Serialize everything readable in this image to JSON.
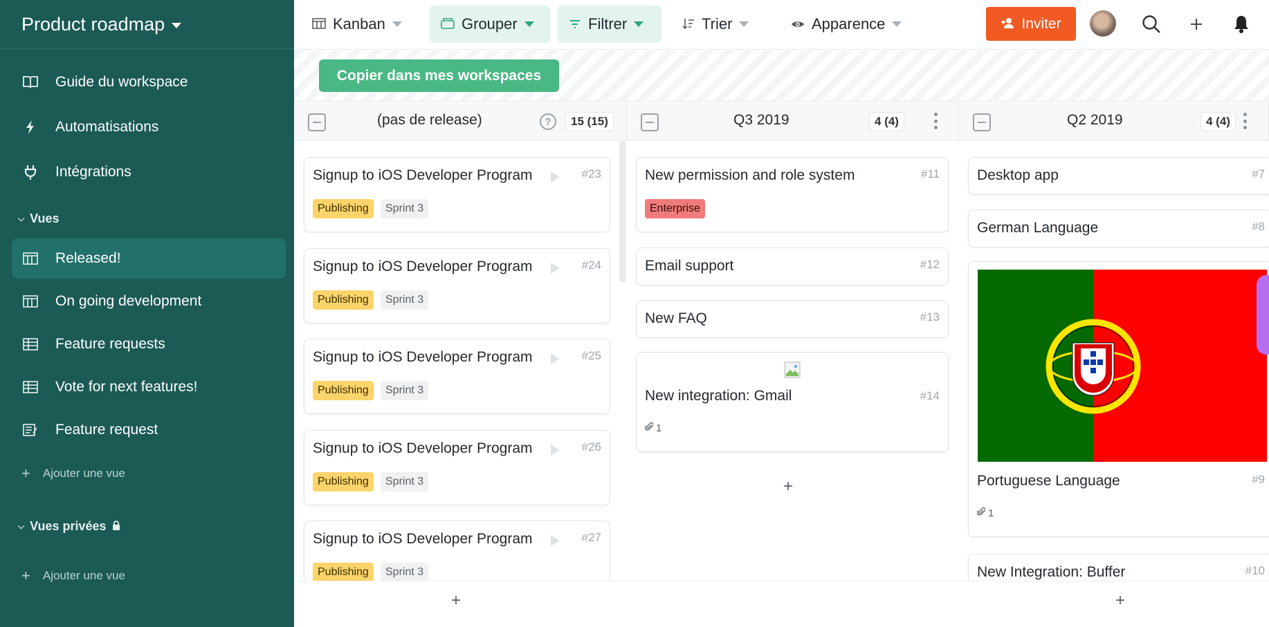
{
  "sidebar": {
    "title": "Product roadmap",
    "items": [
      {
        "label": "Guide du workspace",
        "icon": "book-icon"
      },
      {
        "label": "Automatisations",
        "icon": "bolt-icon"
      },
      {
        "label": "Intégrations",
        "icon": "plug-icon"
      }
    ],
    "views_section": "Vues",
    "views": [
      {
        "label": "Released!",
        "icon": "kanban-icon",
        "active": true
      },
      {
        "label": "On going development",
        "icon": "kanban-icon",
        "active": false
      },
      {
        "label": "Feature requests",
        "icon": "table-icon",
        "active": false
      },
      {
        "label": "Vote for next features!",
        "icon": "table-icon",
        "active": false
      },
      {
        "label": "Feature request",
        "icon": "form-icon",
        "active": false
      }
    ],
    "add_view": "Ajouter une vue",
    "private_section": "Vues privées",
    "add_private_view": "Ajouter une vue"
  },
  "toolbar": {
    "kanban": "Kanban",
    "group": "Grouper",
    "filter": "Filtrer",
    "sort": "Trier",
    "appearance": "Apparence",
    "invite": "Inviter"
  },
  "banner": {
    "copy": "Copier dans mes workspaces"
  },
  "columns": [
    {
      "title": "(pas de release)",
      "count": "15 (15)",
      "cards": [
        {
          "title": "Signup to iOS Developer Program",
          "id": "#23",
          "tags": [
            "Publishing",
            "Sprint 3"
          ]
        },
        {
          "title": "Signup to iOS Developer Program",
          "id": "#24",
          "tags": [
            "Publishing",
            "Sprint 3"
          ]
        },
        {
          "title": "Signup to iOS Developer Program",
          "id": "#25",
          "tags": [
            "Publishing",
            "Sprint 3"
          ]
        },
        {
          "title": "Signup to iOS Developer Program",
          "id": "#26",
          "tags": [
            "Publishing",
            "Sprint 3"
          ]
        },
        {
          "title": "Signup to iOS Developer Program",
          "id": "#27",
          "tags": [
            "Publishing",
            "Sprint 3"
          ]
        }
      ]
    },
    {
      "title": "Q3 2019",
      "count": "4 (4)",
      "cards": [
        {
          "title": "New permission and role system",
          "id": "#11",
          "tags": [
            "Enterprise"
          ]
        },
        {
          "title": "Email support",
          "id": "#12"
        },
        {
          "title": "New FAQ",
          "id": "#13"
        },
        {
          "title": "New integration: Gmail",
          "id": "#14",
          "attachments": "1"
        }
      ]
    },
    {
      "title": "Q2 2019",
      "count": "4 (4)",
      "cards": [
        {
          "title": "Desktop app",
          "id": "#7"
        },
        {
          "title": "German Language",
          "id": "#8"
        },
        {
          "title": "Portuguese Language",
          "id": "#9",
          "attachments": "1"
        },
        {
          "title": "New Integration: Buffer",
          "id": "#10"
        }
      ]
    }
  ],
  "colors": {
    "sidebar": "#1b5a55",
    "accent_green": "#49b884",
    "invite_orange": "#f15a22",
    "tag_publishing": "#fcd46b",
    "tag_enterprise": "#ef7b7b"
  }
}
